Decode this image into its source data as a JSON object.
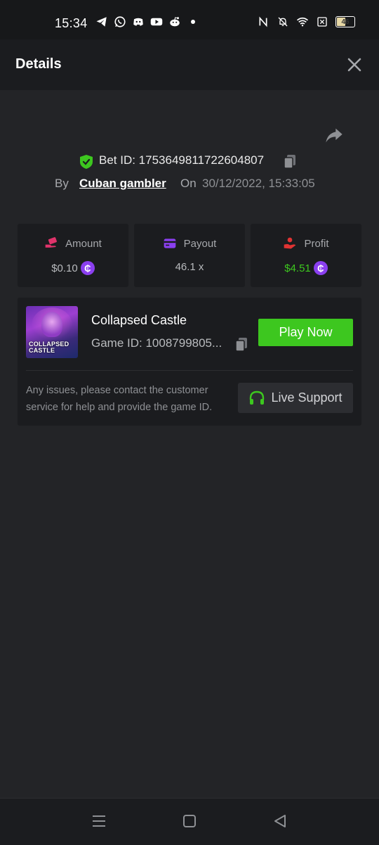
{
  "status_bar": {
    "time": "15:34",
    "battery_level": "46",
    "left_icons": [
      "telegram-icon",
      "whatsapp-icon",
      "discord-icon",
      "youtube-icon",
      "reddit-icon",
      "dot-icon"
    ],
    "right_icons": [
      "nfc-icon",
      "mute-icon",
      "wifi-icon",
      "sim-off-icon",
      "battery-icon"
    ]
  },
  "header": {
    "title": "Details",
    "close_icon": "close-icon"
  },
  "bet": {
    "label": "Bet ID: 1753649811722604807",
    "by_label": "By",
    "user": "Cuban gambler",
    "on_label": "On",
    "date": "30/12/2022, 15:33:05"
  },
  "stats": {
    "amount": {
      "label": "Amount",
      "value": "$0.10",
      "icon": "money-hand-icon"
    },
    "payout": {
      "label": "Payout",
      "value": "46.1 x",
      "icon": "card-icon"
    },
    "profit": {
      "label": "Profit",
      "value": "$4.51",
      "icon": "hand-coin-icon"
    }
  },
  "game": {
    "name": "Collapsed Castle",
    "id_text": "Game ID: 1008799805...",
    "thumb_text_1": "COLLAPSED",
    "thumb_text_2": "CASTLE",
    "play_label": "Play Now",
    "help_text": "Any issues, please contact the customer service for help and provide the game ID.",
    "support_label": "Live Support"
  },
  "colors": {
    "accent_green": "#3dc71f",
    "profit_green": "#3dc71f",
    "coin_purple": "#8b3ff0",
    "background": "#232427"
  }
}
